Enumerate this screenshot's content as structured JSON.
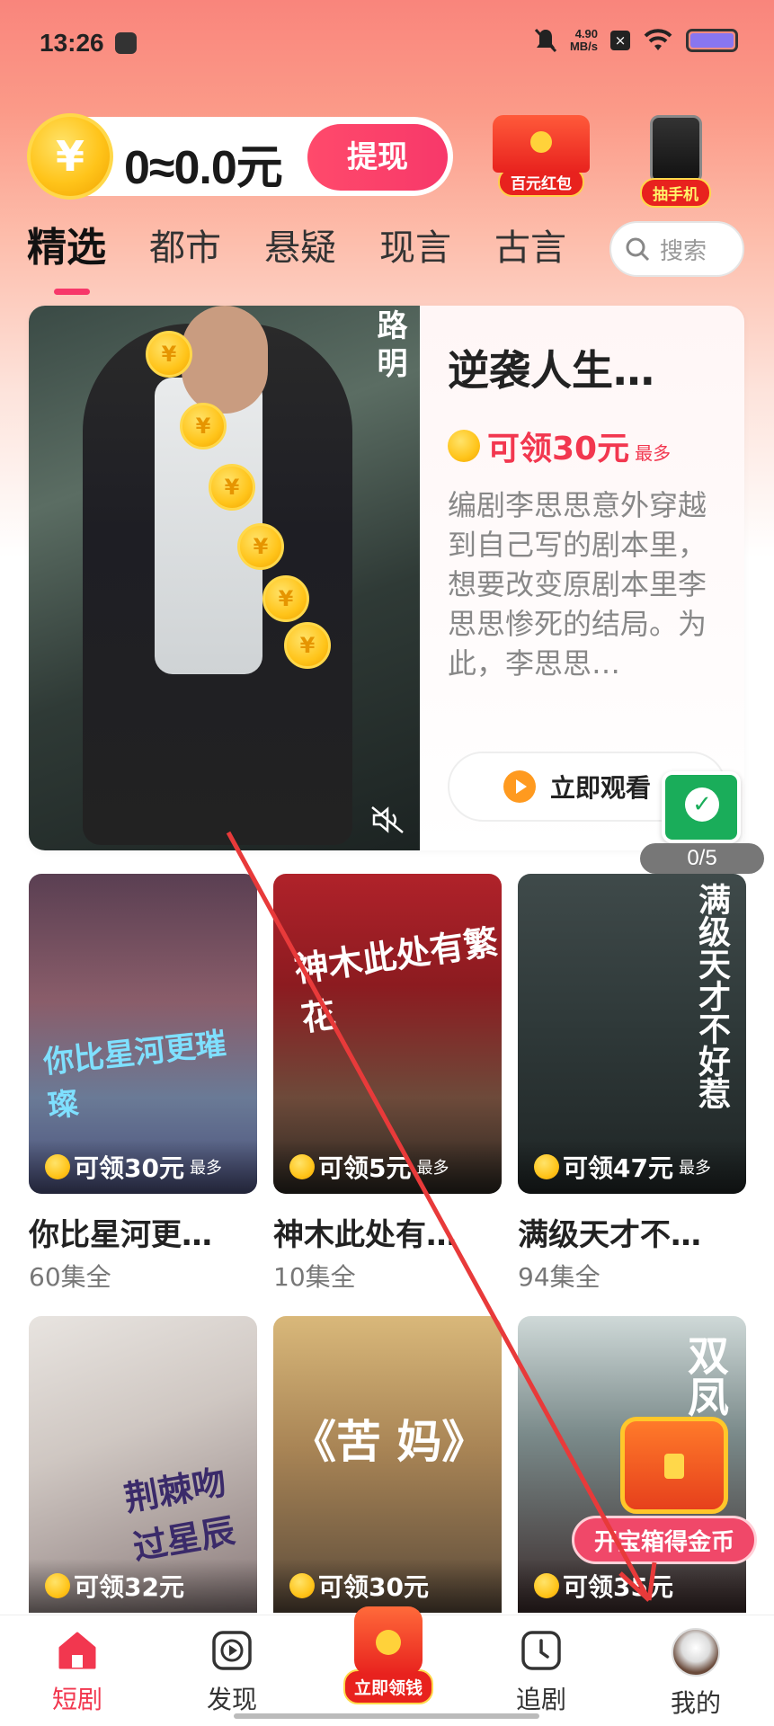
{
  "status_bar": {
    "time": "13:26",
    "net_speed_value": "4.90",
    "net_speed_unit": "MB/s"
  },
  "header": {
    "coin_symbol": "¥",
    "balance": "0≈0.0元",
    "withdraw_label": "提现",
    "promo_redpacket_label": "百元红包",
    "promo_phone_label": "抽手机"
  },
  "tabs": [
    {
      "label": "精选",
      "active": true
    },
    {
      "label": "都市",
      "active": false
    },
    {
      "label": "悬疑",
      "active": false
    },
    {
      "label": "现言",
      "active": false
    },
    {
      "label": "古言",
      "active": false
    }
  ],
  "search": {
    "placeholder": "搜索"
  },
  "featured": {
    "poster_vertical_title": "路明",
    "title": "逆袭人生…",
    "reward": "可领30元",
    "reward_note": "最多",
    "description": "编剧李思思意外穿越到自己写的剧本里，想要改变原剧本里李思思惨死的结局。为此，李思思…",
    "watch_label": "立即观看"
  },
  "floating_widget": {
    "progress": "0/5"
  },
  "grid": [
    {
      "poster_text": "你比星河更璀璨",
      "reward": "可领30元",
      "reward_note": "最多",
      "title": "你比星河更…",
      "episodes": "60集全"
    },
    {
      "poster_text": "神木此处有繁花",
      "reward": "可领5元",
      "reward_note": "最多",
      "title": "神木此处有…",
      "episodes": "10集全"
    },
    {
      "poster_text": "满级天才不好惹",
      "reward": "可领47元",
      "reward_note": "最多",
      "title": "满级天才不…",
      "episodes": "94集全"
    },
    {
      "poster_text": "荆棘吻过星辰",
      "reward": "可领32元",
      "reward_note": "",
      "title": "",
      "episodes": ""
    },
    {
      "poster_text": "《苦 妈》",
      "reward": "可领30元",
      "reward_note": "",
      "title": "",
      "episodes": ""
    },
    {
      "poster_text": "双凤",
      "reward": "可领35元",
      "reward_note": "",
      "title": "",
      "episodes": ""
    }
  ],
  "treasure": {
    "label": "开宝箱得金币"
  },
  "bottom_nav": [
    {
      "label": "短剧",
      "icon": "home-icon",
      "active": true
    },
    {
      "label": "发现",
      "icon": "play-square-icon",
      "active": false
    },
    {
      "label": "立即领钱",
      "icon": "red-packet-icon",
      "active": false
    },
    {
      "label": "追剧",
      "icon": "clock-icon",
      "active": false
    },
    {
      "label": "我的",
      "icon": "avatar",
      "active": false
    }
  ],
  "colors": {
    "accent": "#f2374f",
    "withdraw": "#f7386a",
    "coin": "#ffc41a",
    "widget_green": "#1aad5a"
  }
}
